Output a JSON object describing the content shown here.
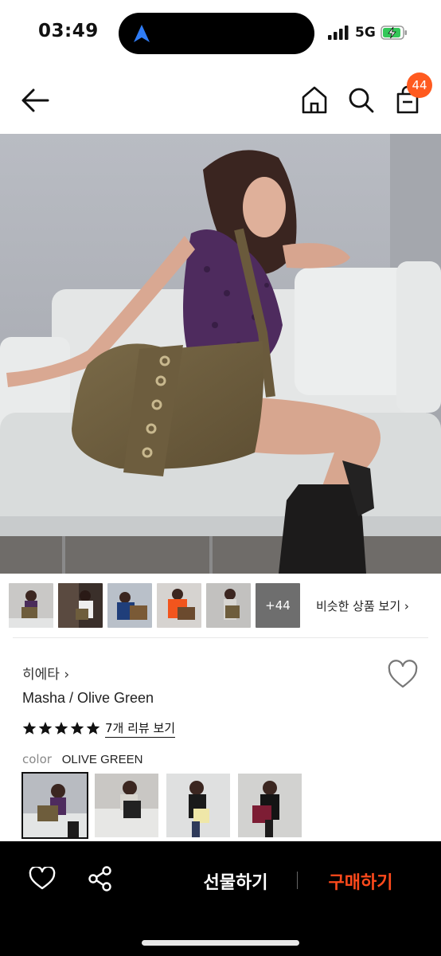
{
  "status_bar": {
    "time": "03:49",
    "network": "5G"
  },
  "header": {
    "cart_count": "44"
  },
  "hero": {
    "image": "model-with-olive-suede-shoulder-bag"
  },
  "thumbnails": {
    "items": [
      "model-bag-1",
      "model-bag-2",
      "model-bag-3",
      "model-bag-4",
      "model-bag-5"
    ],
    "more_label": "+44",
    "similar_label": "비슷한 상품 보기 ›"
  },
  "product": {
    "brand": "히에타 ›",
    "name": "Masha / Olive Green",
    "rating": 5,
    "review_label": "7개 리뷰 보기",
    "color_label": "color",
    "color_value": "OLIVE GREEN",
    "swatches": [
      "olive-green",
      "black",
      "butter",
      "burgundy"
    ]
  },
  "bottom_bar": {
    "gift_label": "선물하기",
    "buy_label": "구매하기"
  },
  "colors": {
    "accent": "#ff4a1c",
    "badge": "#ff5a1f",
    "bar": "#000000"
  }
}
